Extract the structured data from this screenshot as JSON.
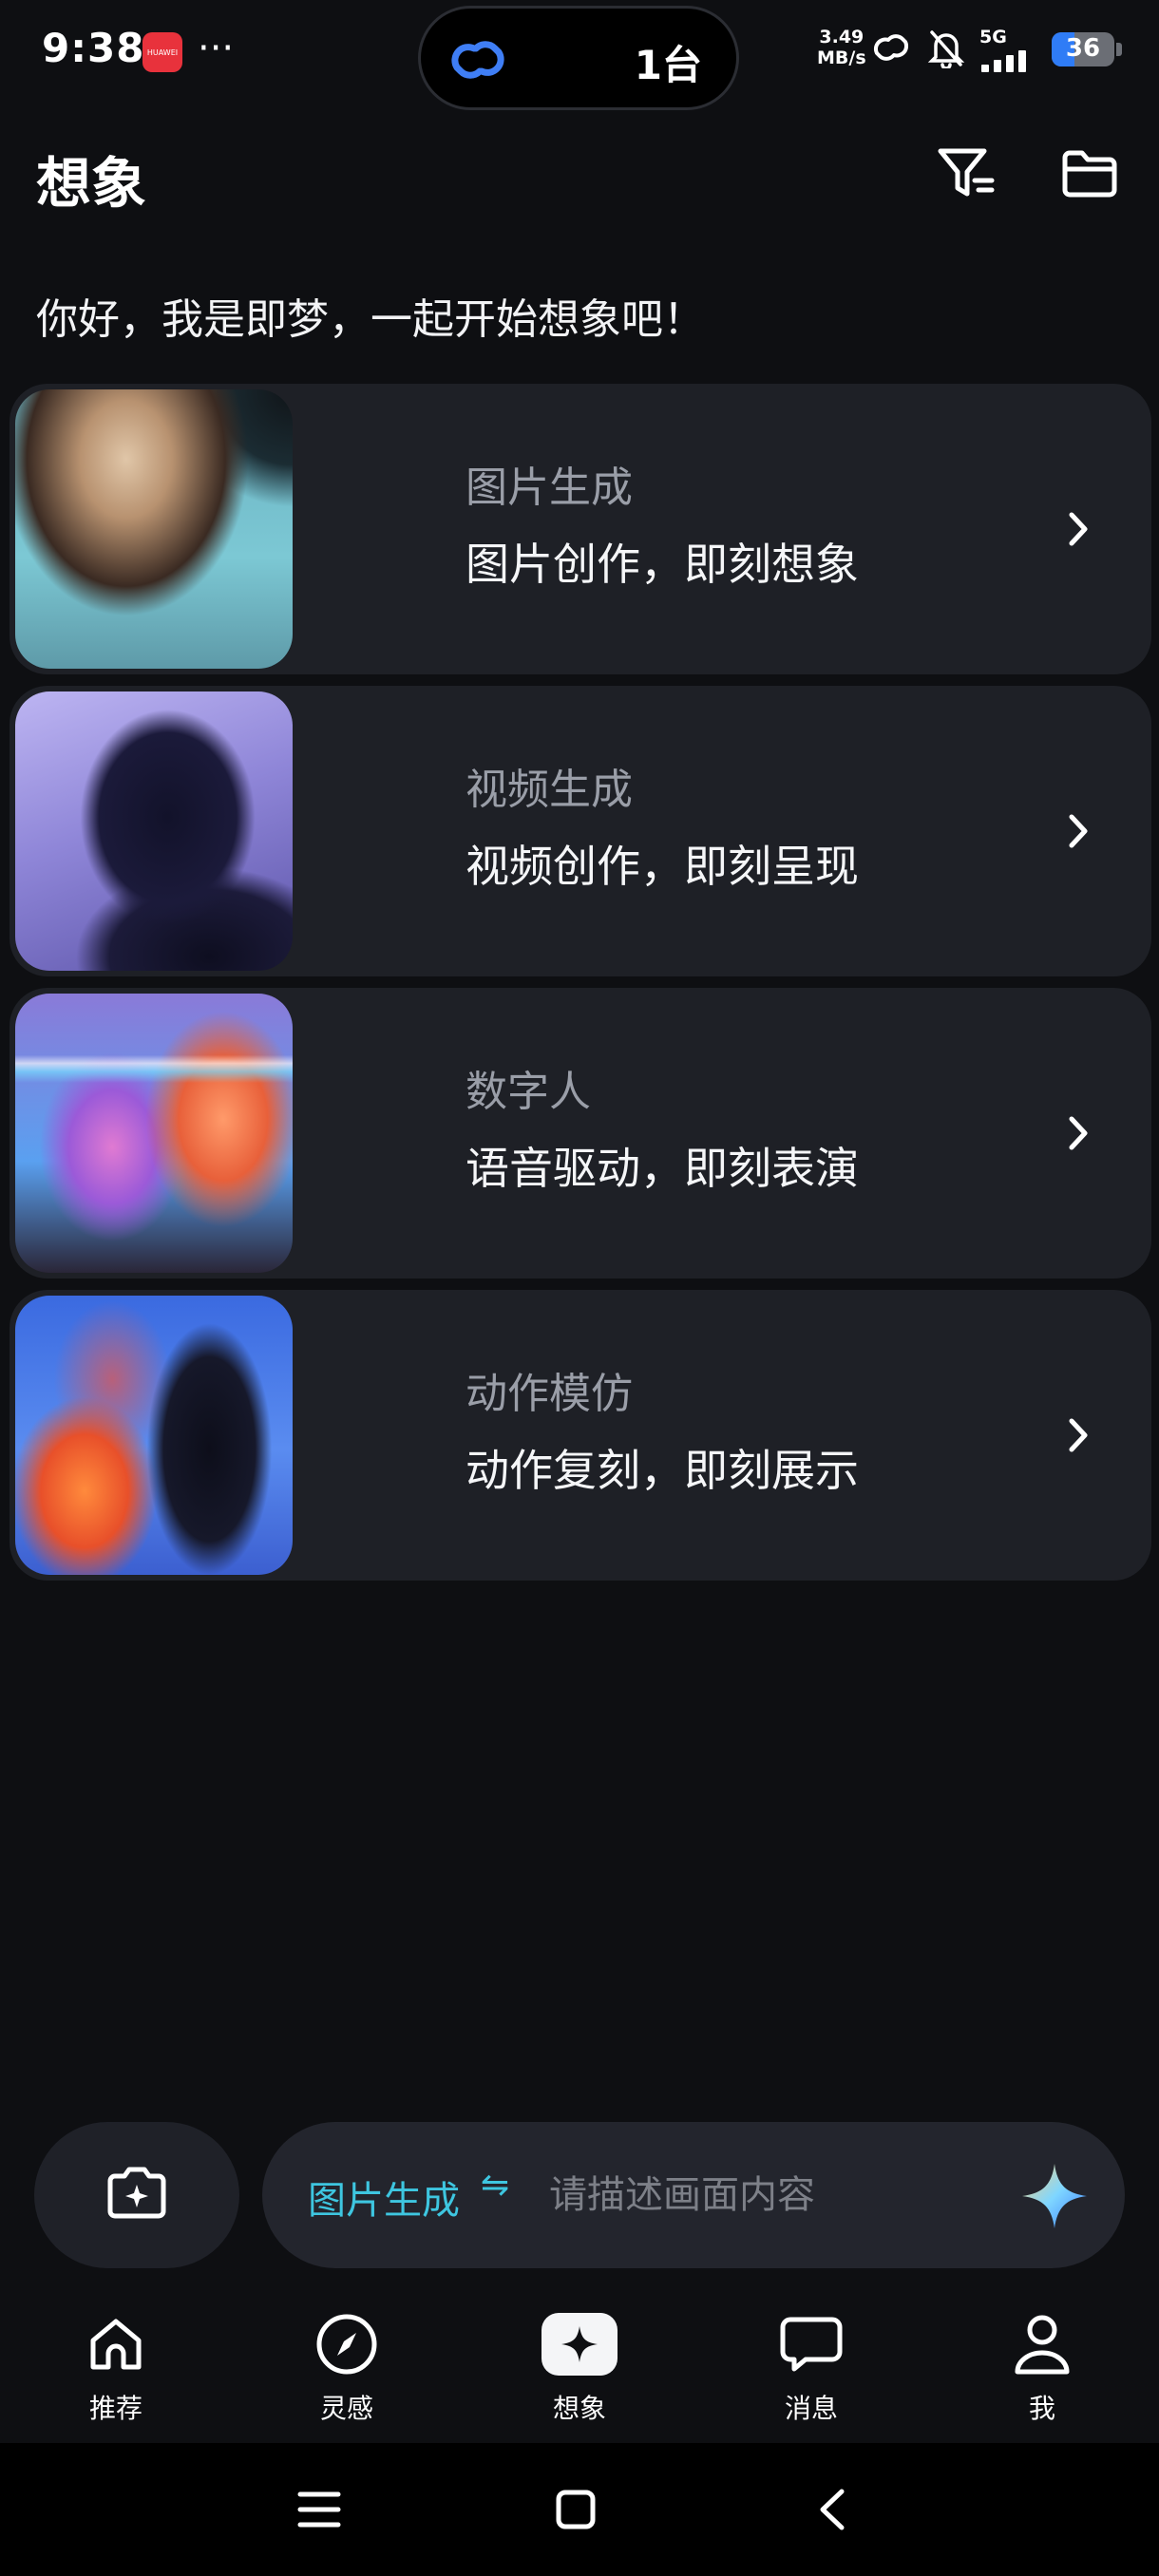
{
  "status_bar": {
    "time": "9:38",
    "app_icon_text": "HUAWEI",
    "more": "···",
    "island_text": "1台",
    "net_speed_value": "3.49",
    "net_speed_unit": "MB/s",
    "network": "5G",
    "battery": "36",
    "battery_level": 0.36,
    "icons": [
      "link-icon",
      "bell-off-icon",
      "signal-icon",
      "battery-icon"
    ]
  },
  "header": {
    "title": "想象",
    "icons": [
      "filter-icon",
      "folder-icon"
    ]
  },
  "greeting": "你好，我是即梦，一起开始想象吧！",
  "cards": [
    {
      "title": "图片生成",
      "subtitle": "图片创作，即刻想象"
    },
    {
      "title": "视频生成",
      "subtitle": "视频创作，即刻呈现"
    },
    {
      "title": "数字人",
      "subtitle": "语音驱动，即刻表演"
    },
    {
      "title": "动作模仿",
      "subtitle": "动作复刻，即刻展示"
    }
  ],
  "composer": {
    "mode": "图片生成",
    "swap_symbol": "⇋",
    "placeholder": "请描述画面内容",
    "accent": "#3ec6e0"
  },
  "tabs": [
    {
      "label": "推荐",
      "icon": "home-icon"
    },
    {
      "label": "灵感",
      "icon": "compass-icon"
    },
    {
      "label": "想象",
      "icon": "sparkle-icon",
      "active": true
    },
    {
      "label": "消息",
      "icon": "chat-icon"
    },
    {
      "label": "我",
      "icon": "person-icon"
    }
  ],
  "nav_bar": [
    "menu-icon",
    "home-square-icon",
    "back-icon"
  ]
}
